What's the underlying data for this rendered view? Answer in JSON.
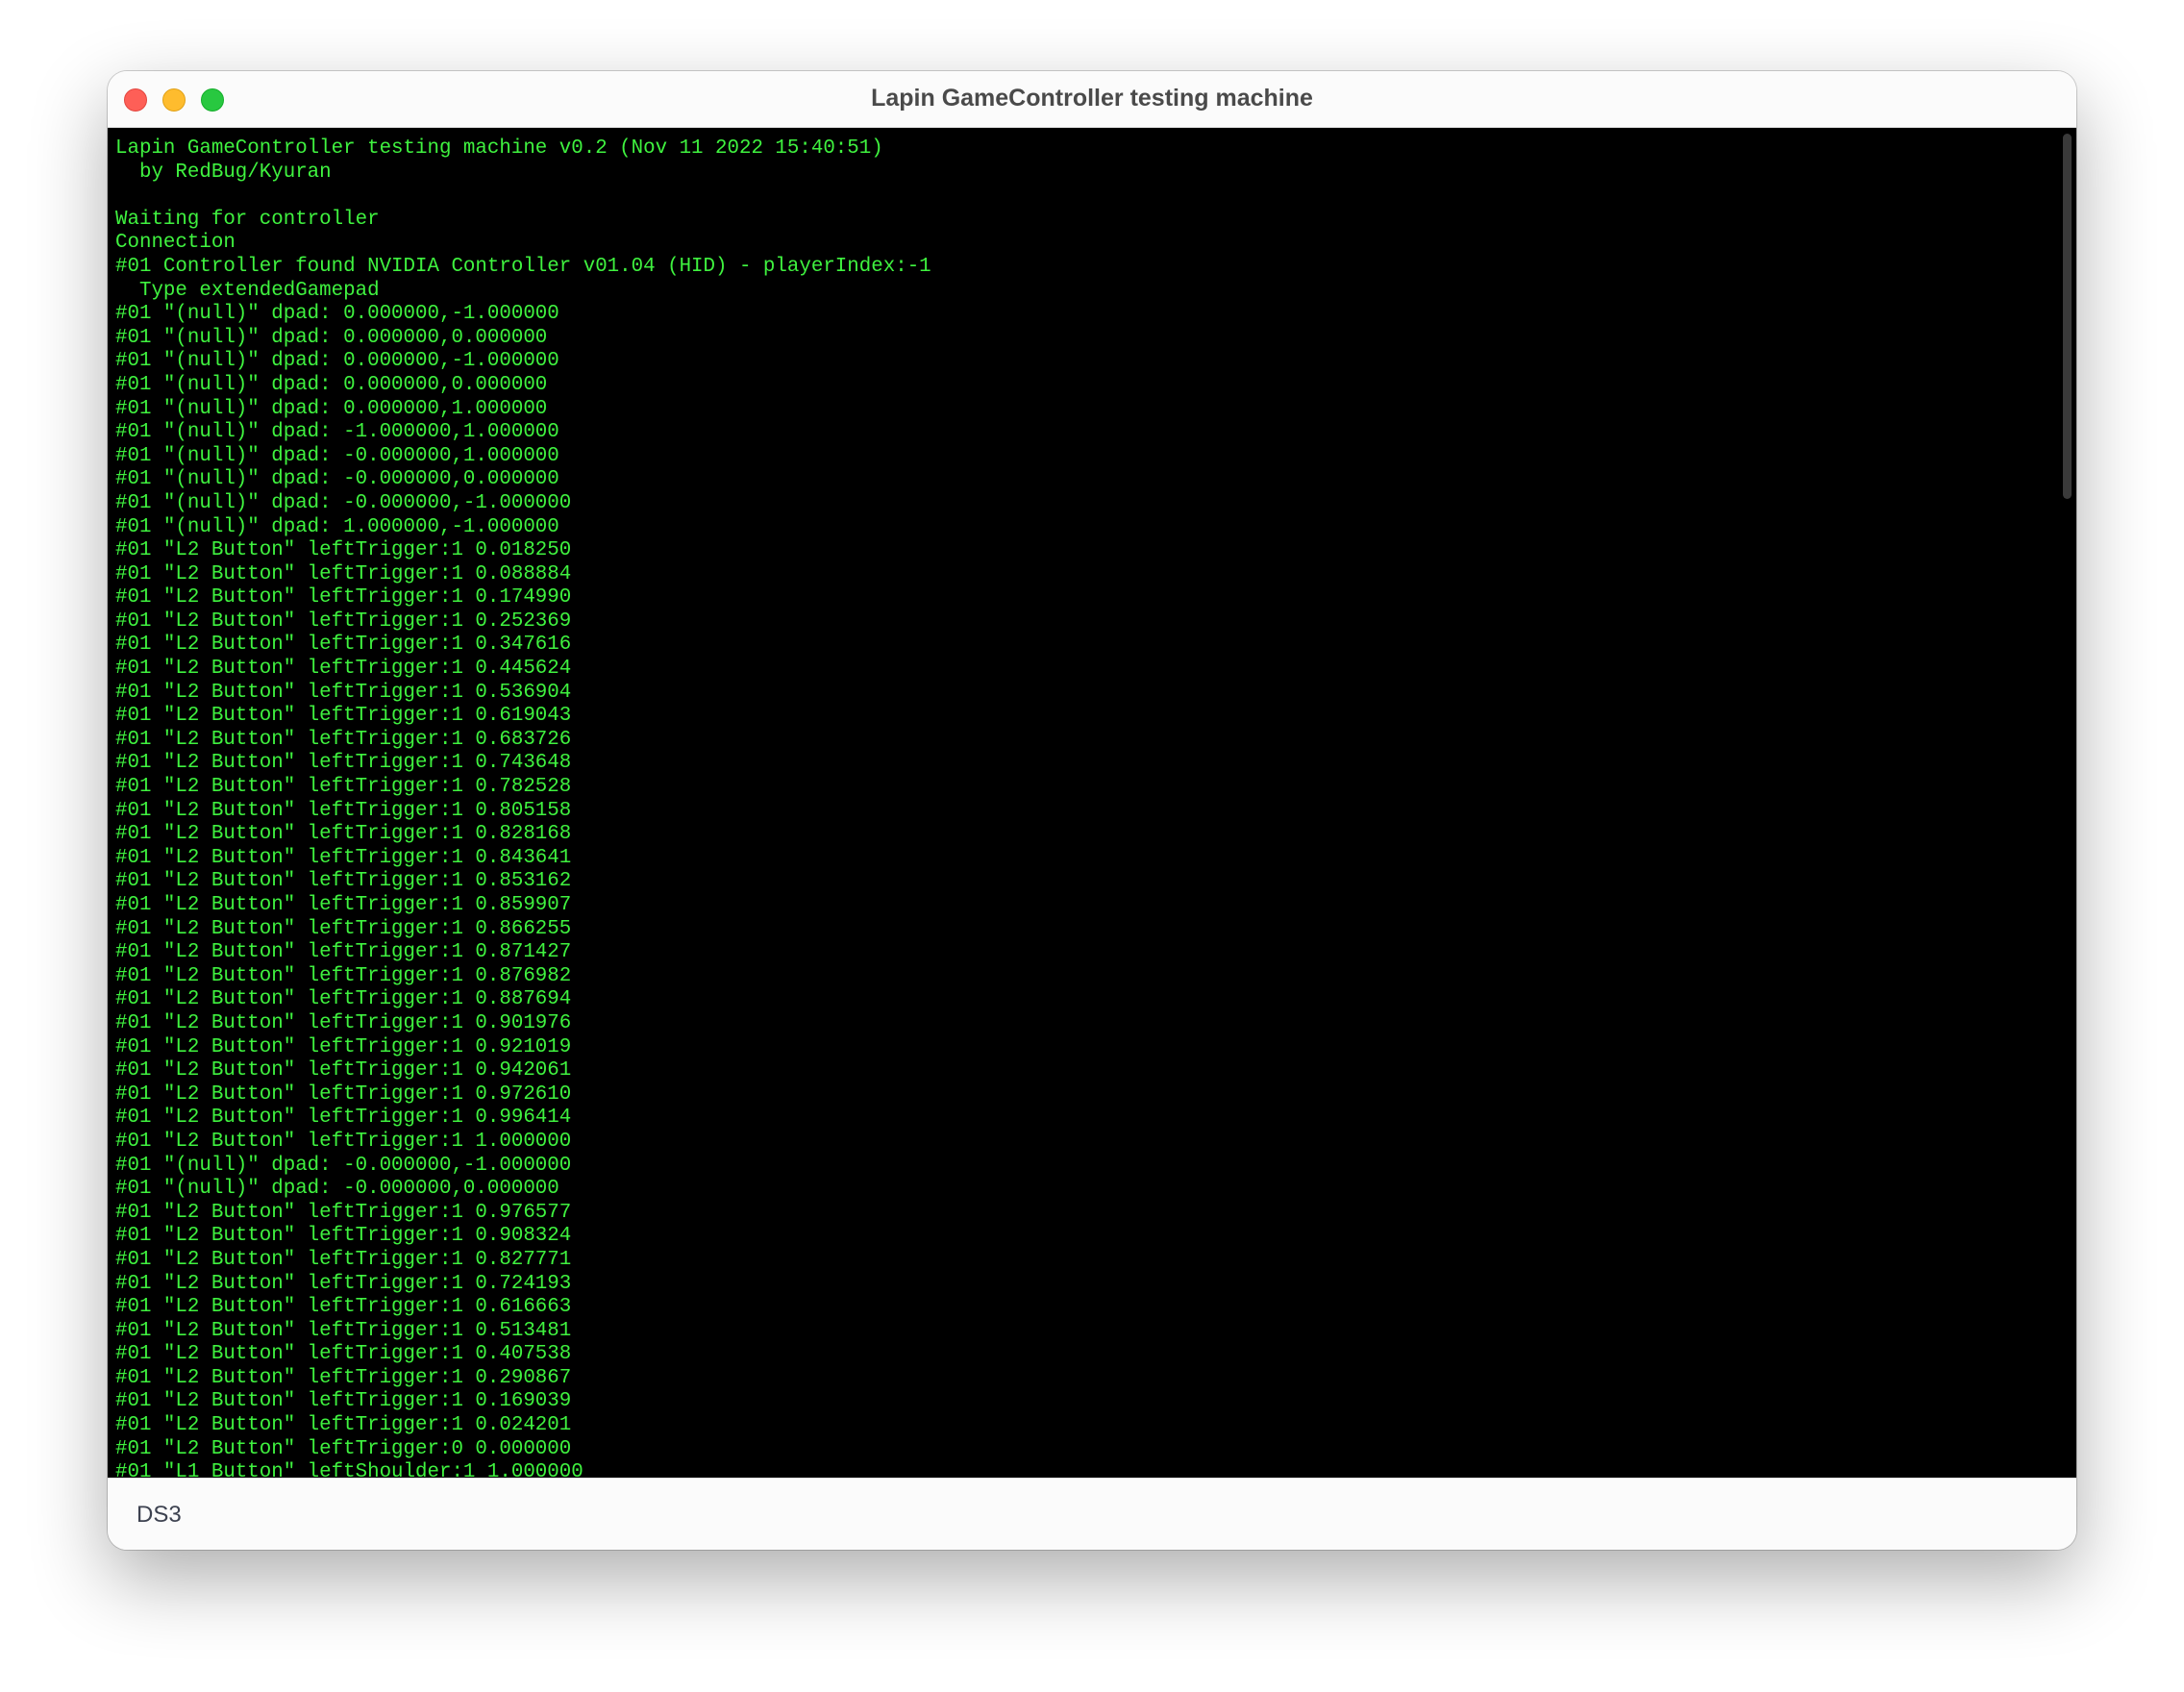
{
  "window": {
    "title": "Lapin GameController testing machine",
    "status_text": "DS3"
  },
  "colors": {
    "console_background": "#000000",
    "console_text": "#3ff23f",
    "close_button": "#fe5f57",
    "minimize_button": "#febc2e",
    "zoom_button": "#28c840"
  },
  "console": {
    "lines": [
      "Lapin GameController testing machine v0.2 (Nov 11 2022 15:40:51)",
      "  by RedBug/Kyuran",
      "",
      "Waiting for controller",
      "Connection",
      "#01 Controller found NVIDIA Controller v01.04 (HID) - playerIndex:-1",
      "  Type extendedGamepad",
      "#01 \"(null)\" dpad: 0.000000,-1.000000",
      "#01 \"(null)\" dpad: 0.000000,0.000000",
      "#01 \"(null)\" dpad: 0.000000,-1.000000",
      "#01 \"(null)\" dpad: 0.000000,0.000000",
      "#01 \"(null)\" dpad: 0.000000,1.000000",
      "#01 \"(null)\" dpad: -1.000000,1.000000",
      "#01 \"(null)\" dpad: -0.000000,1.000000",
      "#01 \"(null)\" dpad: -0.000000,0.000000",
      "#01 \"(null)\" dpad: -0.000000,-1.000000",
      "#01 \"(null)\" dpad: 1.000000,-1.000000",
      "#01 \"L2 Button\" leftTrigger:1 0.018250",
      "#01 \"L2 Button\" leftTrigger:1 0.088884",
      "#01 \"L2 Button\" leftTrigger:1 0.174990",
      "#01 \"L2 Button\" leftTrigger:1 0.252369",
      "#01 \"L2 Button\" leftTrigger:1 0.347616",
      "#01 \"L2 Button\" leftTrigger:1 0.445624",
      "#01 \"L2 Button\" leftTrigger:1 0.536904",
      "#01 \"L2 Button\" leftTrigger:1 0.619043",
      "#01 \"L2 Button\" leftTrigger:1 0.683726",
      "#01 \"L2 Button\" leftTrigger:1 0.743648",
      "#01 \"L2 Button\" leftTrigger:1 0.782528",
      "#01 \"L2 Button\" leftTrigger:1 0.805158",
      "#01 \"L2 Button\" leftTrigger:1 0.828168",
      "#01 \"L2 Button\" leftTrigger:1 0.843641",
      "#01 \"L2 Button\" leftTrigger:1 0.853162",
      "#01 \"L2 Button\" leftTrigger:1 0.859907",
      "#01 \"L2 Button\" leftTrigger:1 0.866255",
      "#01 \"L2 Button\" leftTrigger:1 0.871427",
      "#01 \"L2 Button\" leftTrigger:1 0.876982",
      "#01 \"L2 Button\" leftTrigger:1 0.887694",
      "#01 \"L2 Button\" leftTrigger:1 0.901976",
      "#01 \"L2 Button\" leftTrigger:1 0.921019",
      "#01 \"L2 Button\" leftTrigger:1 0.942061",
      "#01 \"L2 Button\" leftTrigger:1 0.972610",
      "#01 \"L2 Button\" leftTrigger:1 0.996414",
      "#01 \"L2 Button\" leftTrigger:1 1.000000",
      "#01 \"(null)\" dpad: -0.000000,-1.000000",
      "#01 \"(null)\" dpad: -0.000000,0.000000",
      "#01 \"L2 Button\" leftTrigger:1 0.976577",
      "#01 \"L2 Button\" leftTrigger:1 0.908324",
      "#01 \"L2 Button\" leftTrigger:1 0.827771",
      "#01 \"L2 Button\" leftTrigger:1 0.724193",
      "#01 \"L2 Button\" leftTrigger:1 0.616663",
      "#01 \"L2 Button\" leftTrigger:1 0.513481",
      "#01 \"L2 Button\" leftTrigger:1 0.407538",
      "#01 \"L2 Button\" leftTrigger:1 0.290867",
      "#01 \"L2 Button\" leftTrigger:1 0.169039",
      "#01 \"L2 Button\" leftTrigger:1 0.024201",
      "#01 \"L2 Button\" leftTrigger:0 0.000000",
      "#01 \"L1 Button\" leftShoulder:1 1.000000"
    ]
  }
}
